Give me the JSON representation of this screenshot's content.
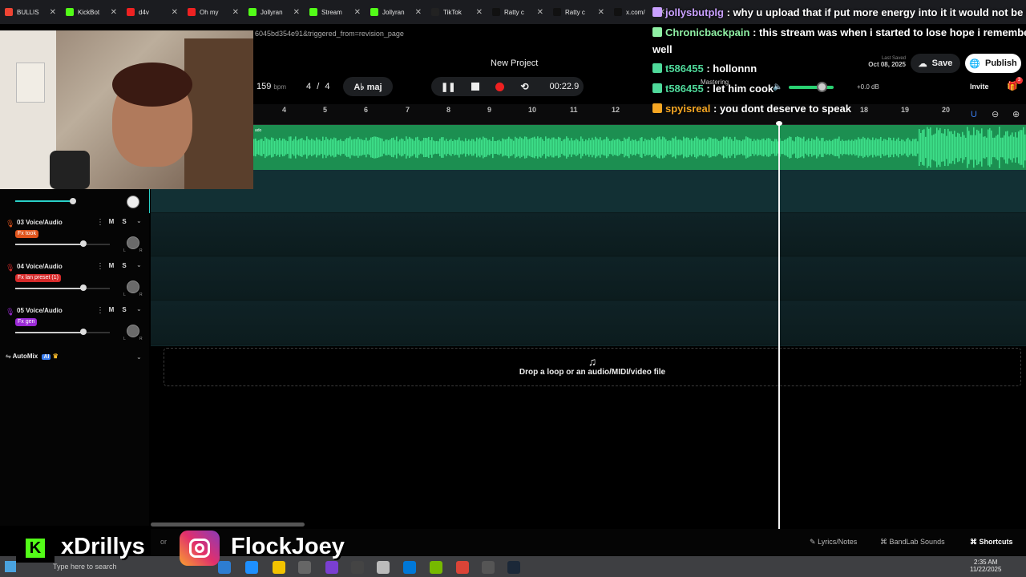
{
  "tabs": [
    {
      "label": "BULLIS",
      "color": "#e43"
    },
    {
      "label": "KickBot",
      "color": "#53fc18"
    },
    {
      "label": "d4v",
      "color": "#e22"
    },
    {
      "label": "Oh my",
      "color": "#e22"
    },
    {
      "label": "Jollyran",
      "color": "#53fc18"
    },
    {
      "label": "Stream",
      "color": "#53fc18"
    },
    {
      "label": "Jollyran",
      "color": "#53fc18"
    },
    {
      "label": "TikTok",
      "color": "#222"
    },
    {
      "label": "Ratty c",
      "color": "#111"
    },
    {
      "label": "Ratty c",
      "color": "#111"
    },
    {
      "label": "x.com/",
      "color": "#111"
    }
  ],
  "url_fragment": "6045bd354e91&triggered_from=revision_page",
  "header": {
    "project_title": "New Project",
    "bpm": "159",
    "bpm_unit": "bpm",
    "time_sig_num": "4",
    "time_sig_den": "4",
    "key": "A♭ maj",
    "time": "00:22.9",
    "mastering": "Mastering",
    "db": "+0.0 dB",
    "last_saved_label": "Last Saved",
    "last_saved_date": "Oct 08, 2025",
    "save": "Save",
    "publish": "Publish",
    "invite": "Invite",
    "gift_badge": "3"
  },
  "ruler": [
    "4",
    "5",
    "6",
    "7",
    "8",
    "9",
    "10",
    "11",
    "12",
    "18",
    "19",
    "20"
  ],
  "waveform_label": "ado",
  "tracks": [
    {
      "number": "03",
      "name": "Voice/Audio",
      "fx": "Fx took",
      "fx_color": "#e0541c",
      "icon_color": "#e0541c",
      "m": "M",
      "s": "S",
      "volume": 0.73
    },
    {
      "number": "04",
      "name": "Voice/Audio",
      "fx": "Fx lan preset (1)",
      "fx_color": "#d62a2a",
      "icon_color": "#d62a2a",
      "m": "M",
      "s": "S",
      "volume": 0.73
    },
    {
      "number": "05",
      "name": "Voice/Audio",
      "fx": "Fx gen",
      "fx_color": "#9b2ad6",
      "icon_color": "#9b2ad6",
      "m": "M",
      "s": "S",
      "volume": 0.73
    }
  ],
  "automix": {
    "label": "AutoMix",
    "ai": "AI"
  },
  "drop_text": "Drop a loop or an audio/MIDI/video file",
  "chat": [
    {
      "user": "jollysbutplg",
      "user_color": "#c9a0ff",
      "text": ": why u upload that if put more energy into it it would not be b"
    },
    {
      "user": "Chronicbackpain",
      "user_color": "#8ff0a4",
      "text": ": this stream was when i started to lose hope i remembe"
    },
    {
      "user": "",
      "user_color": "#fff",
      "text": "well"
    },
    {
      "user": "t586455",
      "user_color": "#4fd99a",
      "text": ": hollonnn"
    },
    {
      "user": "t586455",
      "user_color": "#4fd99a",
      "text": ": let him cook"
    },
    {
      "user": "spyisreal",
      "user_color": "#f5a623",
      "text": ": you dont deserve to speak"
    }
  ],
  "bottom": {
    "lyrics": "Lyrics/Notes",
    "sounds": "BandLab Sounds",
    "shortcuts": "Shortcuts",
    "search": "Type here to search",
    "or": "or"
  },
  "socials": {
    "kick": "xDrillys",
    "instagram": "FlockJoey"
  },
  "clock": {
    "time": "2:35 AM",
    "date": "11/22/2025"
  }
}
